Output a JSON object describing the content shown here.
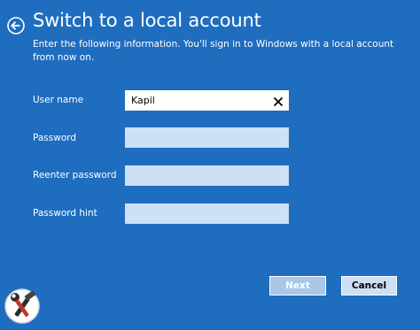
{
  "window": {
    "title": "Switch to a local account",
    "instructions": "Enter the following information. You'll sign in to Windows with a local account from now on."
  },
  "form": {
    "username_label": "User name",
    "username_value": "Kapil",
    "password_label": "Password",
    "password_value": "",
    "reenter_label": "Reenter password",
    "reenter_value": "",
    "hint_label": "Password hint",
    "hint_value": ""
  },
  "buttons": {
    "next_label": "Next",
    "cancel_label": "Cancel"
  },
  "icons": {
    "back": "arrow-left-circle-icon",
    "clear": "close-icon",
    "watermark": "hammer-wrench-logo"
  },
  "colors": {
    "background": "#1f6dbf",
    "field_empty": "#cde0f5",
    "field_active": "#ffffff",
    "next_disabled": "#a9c7e8"
  }
}
